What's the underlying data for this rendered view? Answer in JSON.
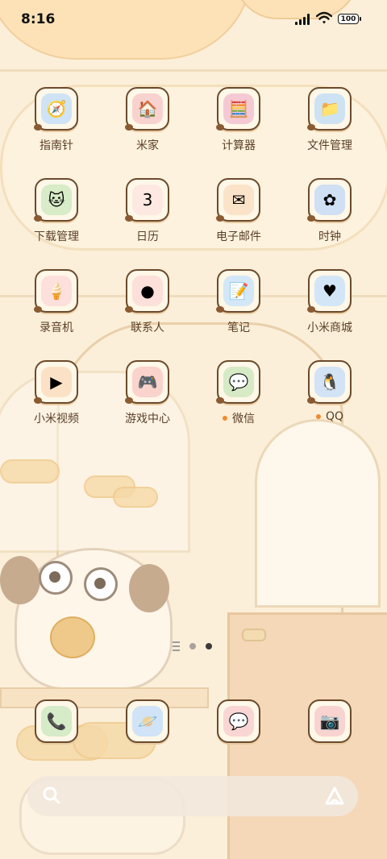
{
  "status_bar": {
    "time": "8:16",
    "battery": "100"
  },
  "apps": [
    {
      "label": "指南针",
      "icon": "compass-icon",
      "glyph": "🧭",
      "color": "#cfe3f7",
      "dot": false
    },
    {
      "label": "米家",
      "icon": "mi-home-icon",
      "glyph": "🏠",
      "color": "#f7d2cf",
      "dot": false
    },
    {
      "label": "计算器",
      "icon": "calculator-icon",
      "glyph": "🧮",
      "color": "#f5c9d3",
      "dot": false
    },
    {
      "label": "文件管理",
      "icon": "folder-icon",
      "glyph": "📁",
      "color": "#cde3f4",
      "dot": false
    },
    {
      "label": "下载管理",
      "icon": "download-cat-icon",
      "glyph": "🐱",
      "color": "#d7ecc7",
      "dot": false
    },
    {
      "label": "日历",
      "icon": "calendar-icon",
      "glyph": "3",
      "color": "#fde9e1",
      "dot": false
    },
    {
      "label": "电子邮件",
      "icon": "email-icon",
      "glyph": "✉",
      "color": "#fbe3c9",
      "dot": false
    },
    {
      "label": "时钟",
      "icon": "clock-icon",
      "glyph": "✿",
      "color": "#cfe0f4",
      "dot": false
    },
    {
      "label": "录音机",
      "icon": "recorder-icon",
      "glyph": "🍦",
      "color": "#fde0dc",
      "dot": false
    },
    {
      "label": "联系人",
      "icon": "contacts-icon",
      "glyph": "●",
      "color": "#fde0d9",
      "dot": false
    },
    {
      "label": "笔记",
      "icon": "notes-icon",
      "glyph": "📝",
      "color": "#d4e7f6",
      "dot": false
    },
    {
      "label": "小米商城",
      "icon": "mi-store-icon",
      "glyph": "♥",
      "color": "#d2e6f7",
      "dot": false
    },
    {
      "label": "小米视频",
      "icon": "mi-video-icon",
      "glyph": "▶",
      "color": "#fbe2c7",
      "dot": false
    },
    {
      "label": "游戏中心",
      "icon": "game-center-icon",
      "glyph": "🎮",
      "color": "#f9d3cc",
      "dot": false
    },
    {
      "label": "微信",
      "icon": "wechat-icon",
      "glyph": "💬",
      "color": "#d6eac6",
      "dot": true
    },
    {
      "label": "QQ",
      "icon": "qq-icon",
      "glyph": "🐧",
      "color": "#d2e3f6",
      "dot": true
    }
  ],
  "dock": [
    {
      "name": "phone",
      "icon": "phone-cat-icon",
      "glyph": "📞",
      "color": "#d6ebc7"
    },
    {
      "name": "browser",
      "icon": "browser-planet-icon",
      "glyph": "🪐",
      "color": "#d0e3f7"
    },
    {
      "name": "messages",
      "icon": "messages-cat-icon",
      "glyph": "💬",
      "color": "#f9d6d3"
    },
    {
      "name": "camera",
      "icon": "camera-pug-icon",
      "glyph": "📷",
      "color": "#f9d3cf"
    }
  ],
  "pager": {
    "pages": 2,
    "current": 2
  },
  "search_bar": {
    "search_icon": "search-icon",
    "assistant_icon": "assistant-icon"
  }
}
